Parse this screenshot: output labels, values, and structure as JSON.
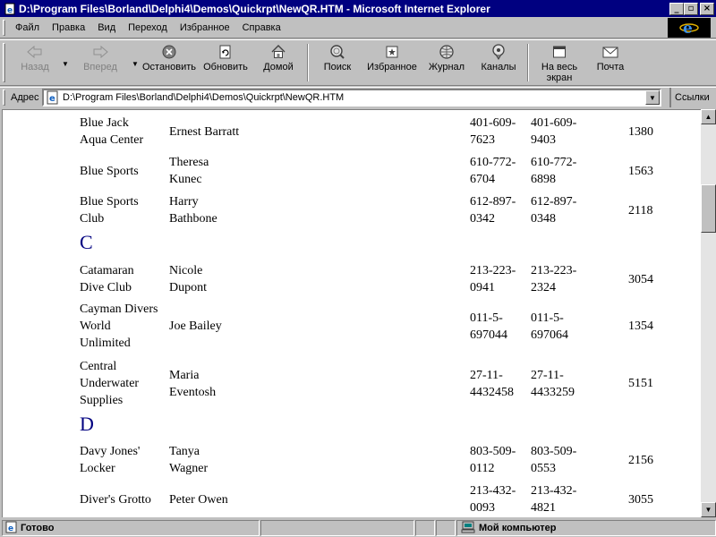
{
  "window": {
    "title": "D:\\Program Files\\Borland\\Delphi4\\Demos\\Quickrpt\\NewQR.HTM - Microsoft Internet Explorer"
  },
  "menu": [
    "Файл",
    "Правка",
    "Вид",
    "Переход",
    "Избранное",
    "Справка"
  ],
  "toolbar": {
    "back": "Назад",
    "forward": "Вперед",
    "stop": "Остановить",
    "refresh": "Обновить",
    "home": "Домой",
    "search": "Поиск",
    "favorites": "Избранное",
    "history": "Журнал",
    "channels": "Каналы",
    "fullscreen_1": "На весь",
    "fullscreen_2": "экран",
    "mail": "Почта"
  },
  "address": {
    "label": "Адрес",
    "value": "D:\\Program Files\\Borland\\Delphi4\\Demos\\Quickrpt\\NewQR.HTM",
    "links": "Ссылки"
  },
  "report": {
    "letter_c": "C",
    "letter_d": "D",
    "rows": [
      {
        "company": [
          "Blue Jack",
          "Aqua Center"
        ],
        "contact": [
          "Ernest Barratt"
        ],
        "phone": [
          "401-609-",
          "7623"
        ],
        "fax": [
          "401-609-",
          "9403"
        ],
        "number": "1380"
      },
      {
        "company": [
          "Blue Sports"
        ],
        "contact": [
          "Theresa",
          "Kunec"
        ],
        "phone": [
          "610-772-",
          "6704"
        ],
        "fax": [
          "610-772-",
          "6898"
        ],
        "number": "1563"
      },
      {
        "company": [
          "Blue Sports",
          "Club"
        ],
        "contact": [
          "Harry",
          "Bathbone"
        ],
        "phone": [
          "612-897-",
          "0342"
        ],
        "fax": [
          "612-897-",
          "0348"
        ],
        "number": "2118"
      },
      {
        "company": [
          "Catamaran",
          "Dive Club"
        ],
        "contact": [
          "Nicole",
          "Dupont"
        ],
        "phone": [
          "213-223-",
          "0941"
        ],
        "fax": [
          "213-223-",
          "2324"
        ],
        "number": "3054"
      },
      {
        "company": [
          "Cayman Divers",
          "World",
          "Unlimited"
        ],
        "contact": [
          "Joe Bailey"
        ],
        "phone": [
          "011-5-",
          "697044"
        ],
        "fax": [
          "011-5-",
          "697064"
        ],
        "number": "1354"
      },
      {
        "company": [
          "Central",
          "Underwater",
          "Supplies"
        ],
        "contact": [
          "Maria",
          "Eventosh"
        ],
        "phone": [
          "27-11-",
          "4432458"
        ],
        "fax": [
          "27-11-",
          "4433259"
        ],
        "number": "5151"
      },
      {
        "company": [
          "Davy Jones'",
          "Locker"
        ],
        "contact": [
          "Tanya",
          "Wagner"
        ],
        "phone": [
          "803-509-",
          "0112"
        ],
        "fax": [
          "803-509-",
          "0553"
        ],
        "number": "2156"
      },
      {
        "company": [
          "Diver's Grotto"
        ],
        "contact": [
          "Peter Owen"
        ],
        "phone": [
          "213-432-",
          "0093"
        ],
        "fax": [
          "213-432-",
          "4821"
        ],
        "number": "3055"
      }
    ]
  },
  "status": {
    "text": "Готово",
    "zone": "Мой компьютер"
  }
}
